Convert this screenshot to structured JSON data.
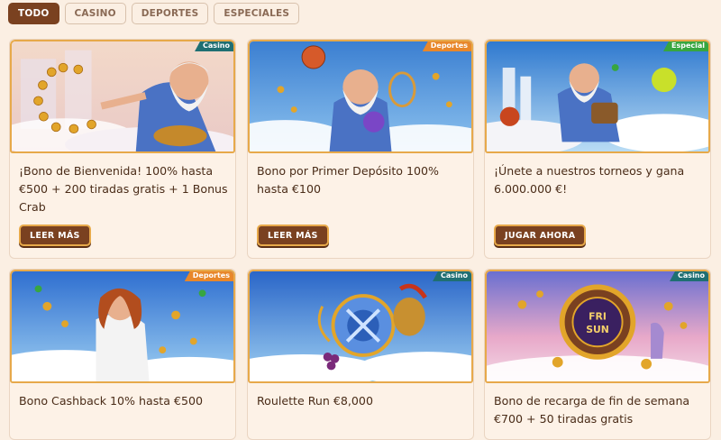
{
  "filters": [
    {
      "label": "TODO"
    },
    {
      "label": "CASINO"
    },
    {
      "label": "DEPORTES"
    },
    {
      "label": "ESPECIALES"
    }
  ],
  "cards": [
    {
      "badge": "Casino",
      "title": "¡Bono de Bienvenida! 100% hasta €500 + 200 tiradas gratis + 1 Bonus Crab",
      "button": "LEER MÁS"
    },
    {
      "badge": "Deportes",
      "title": "Bono por Primer Depósito 100% hasta €100",
      "button": "LEER MÁS"
    },
    {
      "badge": "Especial",
      "title": "¡Únete a nuestros torneos y gana 6.000.000 €!",
      "button": "JUGAR AHORA"
    },
    {
      "badge": "Deportes",
      "title": "Bono Cashback 10% hasta €500"
    },
    {
      "badge": "Casino",
      "title": "Roulette Run €8,000"
    },
    {
      "badge": "Casino",
      "title": "Bono de recarga de fin de semana €700 + 50 tiradas gratis"
    }
  ],
  "art_text": {
    "fri": "FRI",
    "sun": "SUN"
  },
  "colors": {
    "accent": "#7a4120",
    "border": "#e7a94a",
    "casino": "#1f6f73",
    "deportes": "#e8872a",
    "especial": "#37a640"
  }
}
